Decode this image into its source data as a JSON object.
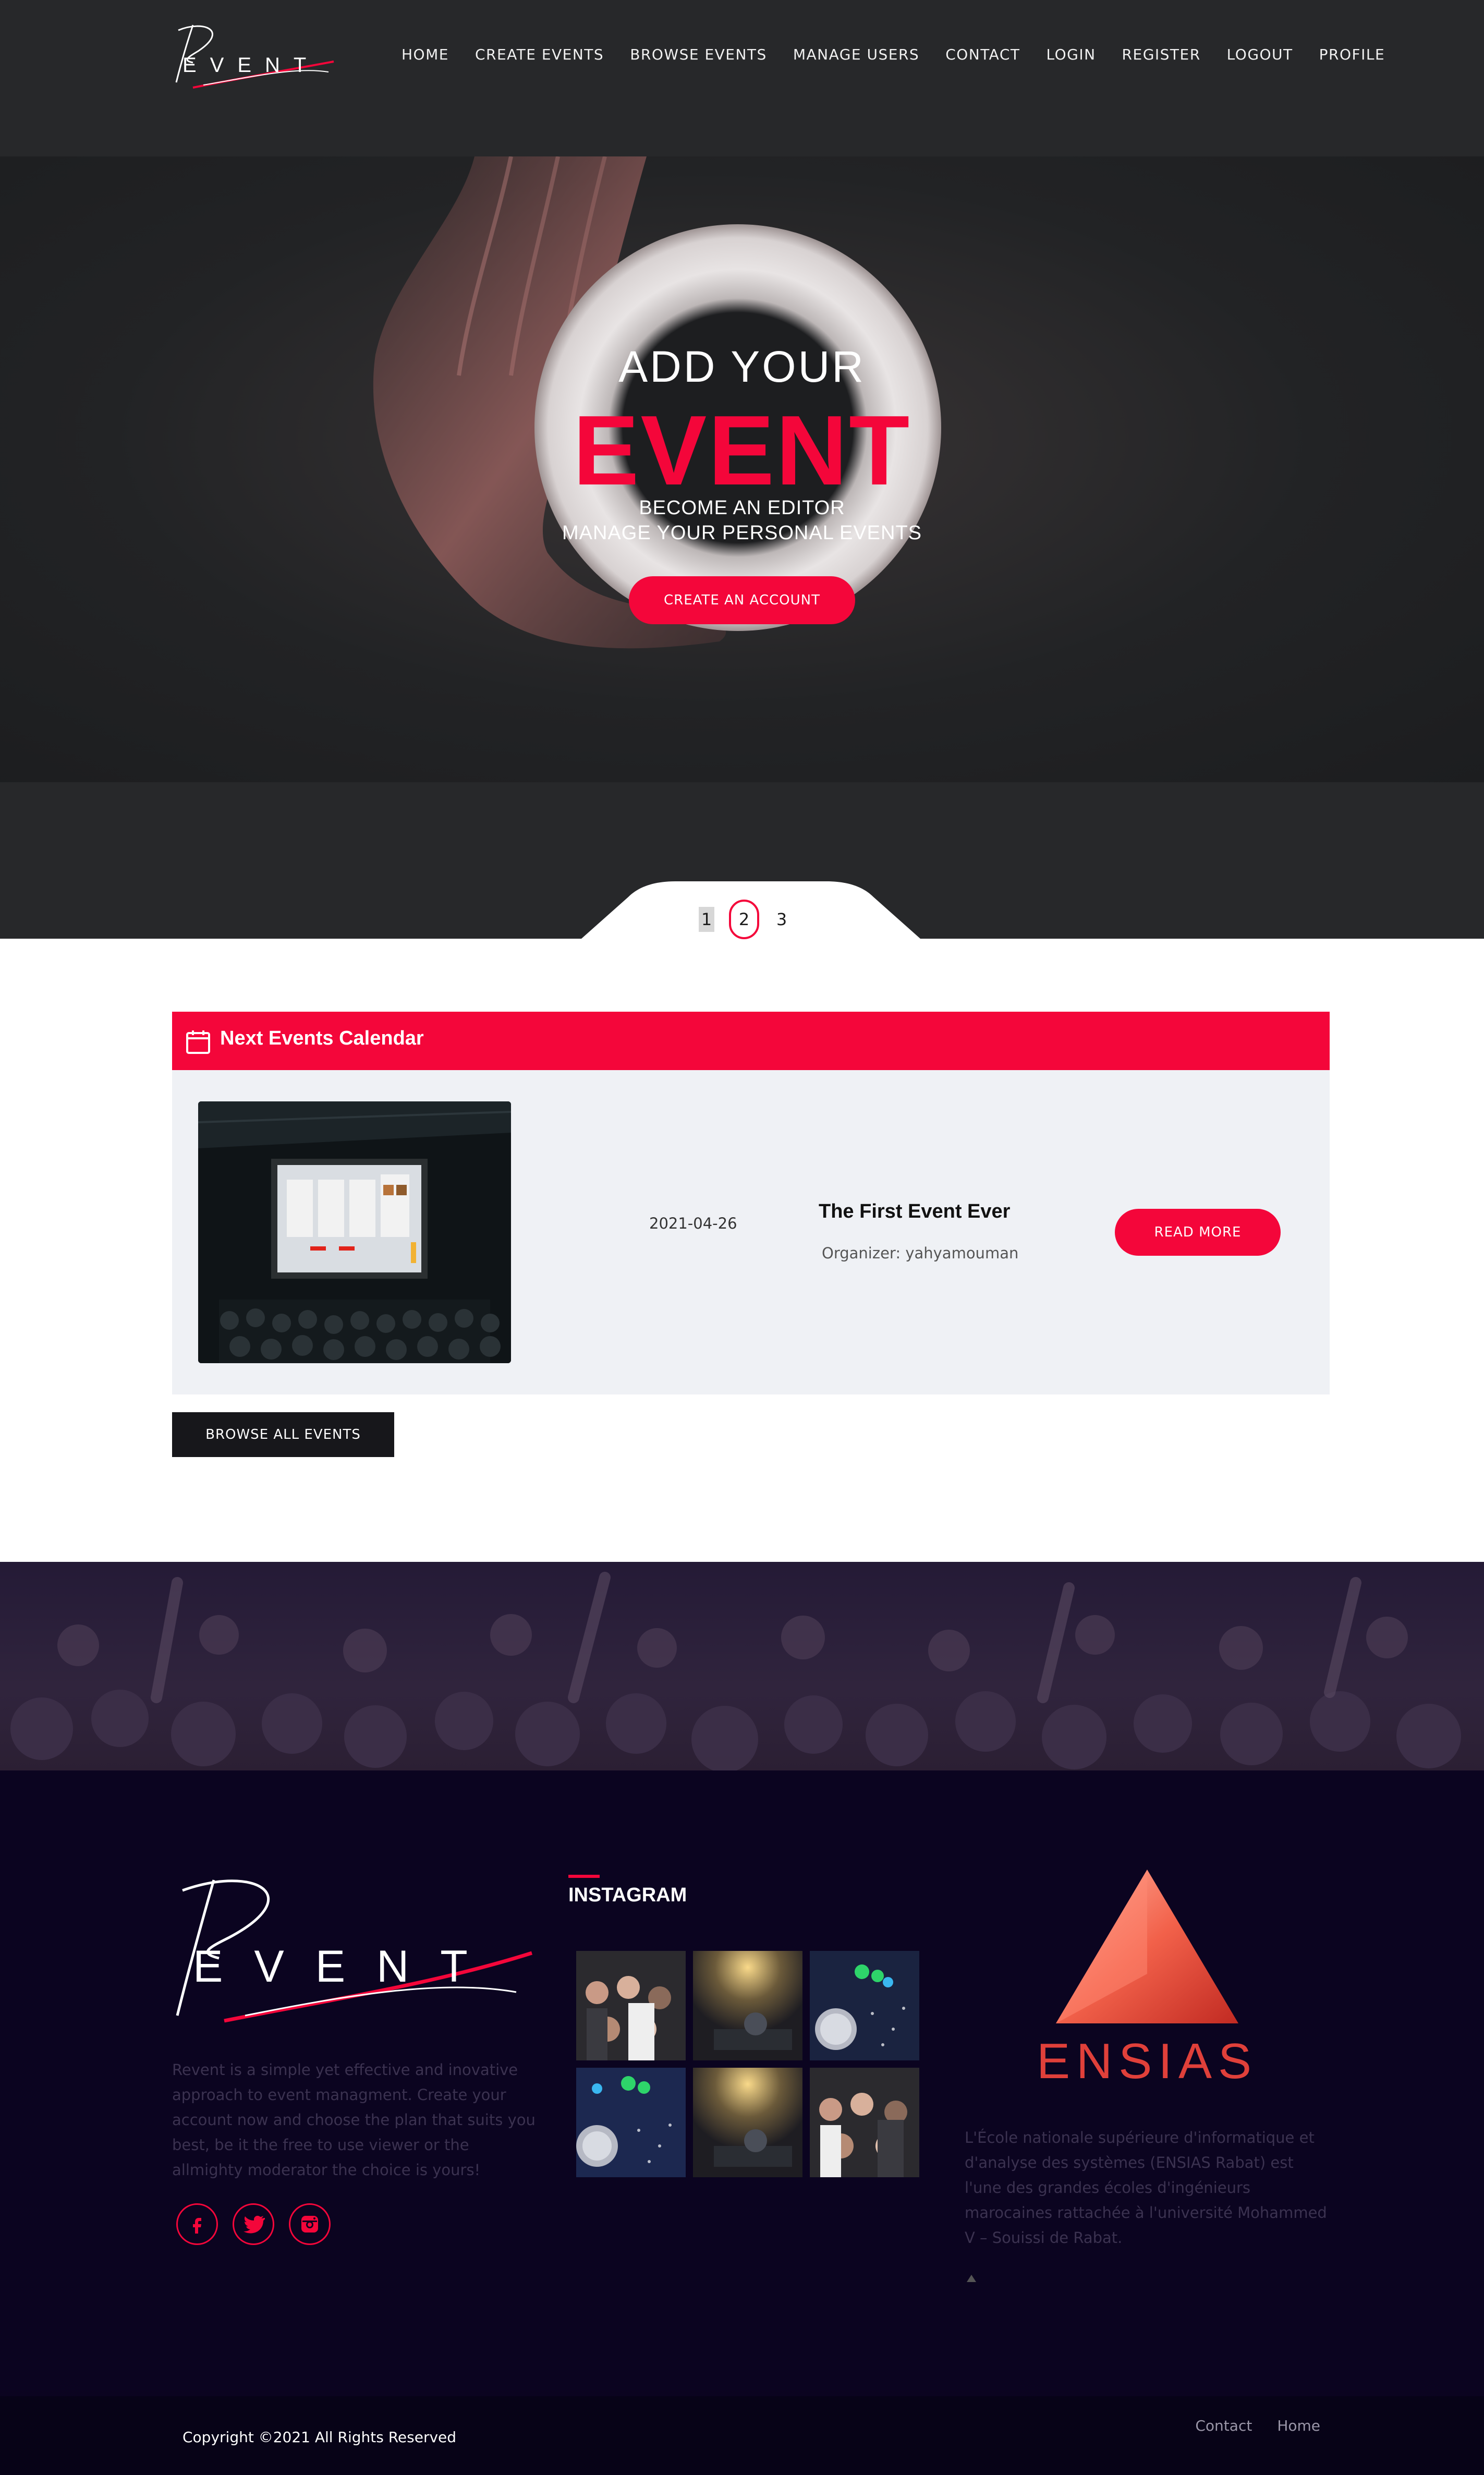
{
  "brand": {
    "logo_text": "EVENT"
  },
  "nav": {
    "items": [
      {
        "label": "HOME"
      },
      {
        "label": "CREATE EVENTS"
      },
      {
        "label": "BROWSE EVENTS"
      },
      {
        "label": "MANAGE USERS"
      },
      {
        "label": "CONTACT"
      },
      {
        "label": "LOGIN"
      },
      {
        "label": "REGISTER"
      },
      {
        "label": "LOGOUT"
      },
      {
        "label": "PROFILE"
      }
    ]
  },
  "hero": {
    "line1": "ADD YOUR",
    "line2": "EVENT",
    "line3": "BECOME AN EDITOR",
    "line4": "MANAGE YOUR PERSONAL EVENTS",
    "cta": "CREATE AN ACCOUNT"
  },
  "pager": {
    "pages": [
      "1",
      "2",
      "3"
    ]
  },
  "events": {
    "heading": "Next Events Calendar",
    "items": [
      {
        "date": "2021-04-26",
        "title": "The First Event Ever",
        "organizer": "Organizer: yahyamouman",
        "cta": "READ MORE"
      }
    ],
    "browse_all": "BROWSE ALL EVENTS"
  },
  "footer": {
    "about": "Revent is a simple yet effective and inovative approach to event managment. Create your account now and choose the plan that suits you best, be it the free to use viewer or the allmighty moderator the choice is yours!",
    "instagram_title": "INSTAGRAM",
    "ensias_logo_text": "ENSIAS",
    "ensias_text": "L'École nationale supérieure d'informatique et d'analyse des systèmes (ENSIAS Rabat) est l'une des grandes écoles d'ingénieurs marocaines rattachée à l'université Mohammed V – Souissi de Rabat.",
    "copyright": "Copyright ©2021 All Rights Reserved",
    "links": [
      {
        "label": "Contact"
      },
      {
        "label": "Home"
      }
    ]
  },
  "colors": {
    "accent": "#f4063a",
    "header_bg": "#27282a",
    "footer_bg": "#0b0420"
  }
}
